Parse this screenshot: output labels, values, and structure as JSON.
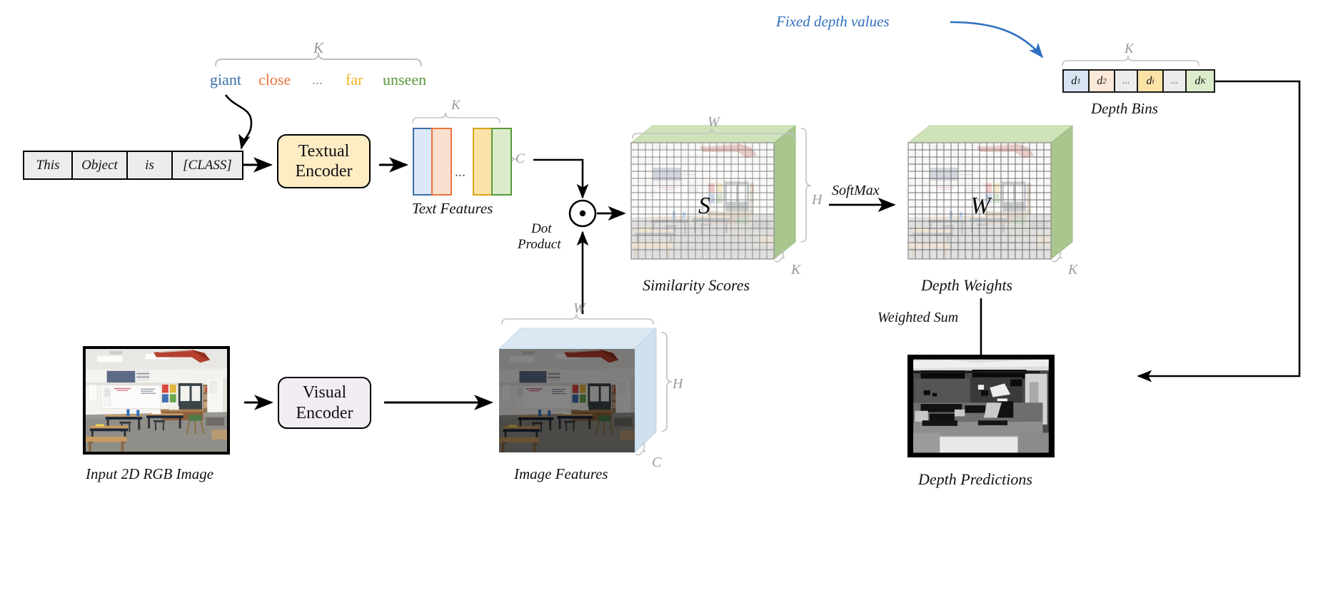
{
  "diagram": {
    "title": "Vision-language depth estimation pipeline",
    "colors": {
      "giant": "#3d6fa8",
      "close": "#e8743b",
      "far": "#f2b21c",
      "unseen": "#57993c",
      "encoder_text_fill": "#fdecc4",
      "encoder_visual_fill": "#f2ecf5",
      "dim_label": "#9a9a9a",
      "annotation_blue": "#2f6fc0",
      "cube_top_green": "#cfe3bb",
      "cube_top_blue": "#d9e8f3"
    }
  },
  "depth_words": {
    "bracket_label": "K",
    "items": [
      {
        "text": "giant",
        "color": "#3d6fa8"
      },
      {
        "text": "close",
        "color": "#e8743b"
      },
      {
        "text": "...",
        "color": "#9a9a9a"
      },
      {
        "text": "far",
        "color": "#f2b21c"
      },
      {
        "text": "unseen",
        "color": "#57993c"
      }
    ]
  },
  "prompt": {
    "tokens": [
      "This",
      "Object",
      "is",
      "[CLASS]"
    ]
  },
  "encoders": {
    "textual": {
      "line1": "Textual",
      "line2": "Encoder"
    },
    "visual": {
      "line1": "Visual",
      "line2": "Encoder"
    }
  },
  "text_features": {
    "caption": "Text Features",
    "bracket_top": "K",
    "bracket_right": "C",
    "ellipsis": "...",
    "bars": [
      {
        "fill": "#dce8f6",
        "stroke": "#3d6fa8"
      },
      {
        "fill": "#fbe0d0",
        "stroke": "#e8743b"
      },
      {
        "fill": "#fbe3a8",
        "stroke": "#d9a414"
      },
      {
        "fill": "#dceccb",
        "stroke": "#57993c"
      }
    ]
  },
  "dot_product": {
    "label_line1": "Dot",
    "label_line2": "Product",
    "symbol": "⊙"
  },
  "similarity_scores": {
    "caption": "Similarity Scores",
    "cube_letter": "S",
    "dim_top": "W",
    "dim_right": "H",
    "dim_depth": "K"
  },
  "softmax": {
    "label": "SoftMax"
  },
  "depth_weights": {
    "caption": "Depth Weights",
    "cube_letter": "W",
    "dim_depth": "K"
  },
  "depth_bins": {
    "caption": "Depth Bins",
    "bracket_label": "K",
    "annotation": "Fixed depth values",
    "cells": [
      {
        "label": "d",
        "sub": "1",
        "fill": "#d7e5f2"
      },
      {
        "label": "d",
        "sub": "2",
        "fill": "#fbe8d8"
      },
      {
        "label": "...",
        "sub": "",
        "fill": "#ececec"
      },
      {
        "label": "d",
        "sub": "i",
        "fill": "#fbe3a8"
      },
      {
        "label": "...",
        "sub": "",
        "fill": "#ececec"
      },
      {
        "label": "d",
        "sub": "K",
        "fill": "#dceccb"
      }
    ]
  },
  "weighted_sum": {
    "label": "Weighted Sum"
  },
  "input_image": {
    "caption": "Input 2D RGB Image"
  },
  "image_features": {
    "caption": "Image Features",
    "dim_top": "W",
    "dim_right": "H",
    "dim_depth": "C"
  },
  "depth_predictions": {
    "caption": "Depth Predictions"
  }
}
